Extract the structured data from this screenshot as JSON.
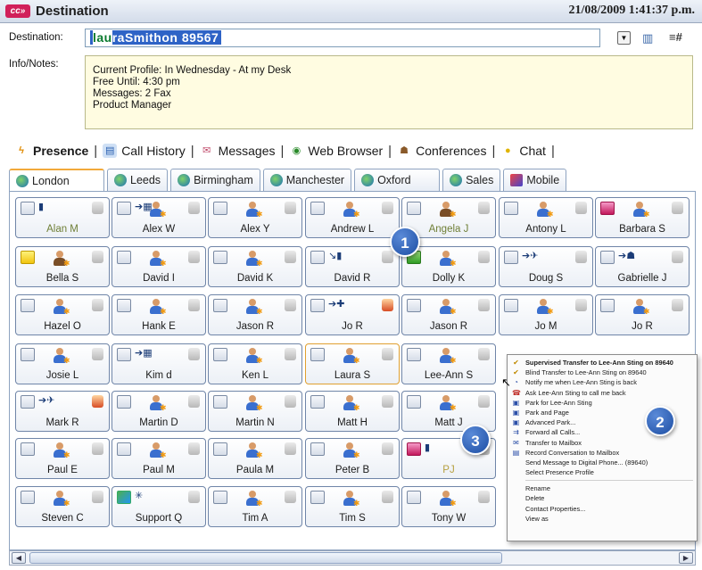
{
  "window": {
    "title": "Destination",
    "datetime": "21/08/2009 1:41:37 p.m."
  },
  "destination": {
    "label": "Destination:",
    "typed": "lau",
    "autocomplete": "raSmithon 89567"
  },
  "info": {
    "label": "Info/Notes:",
    "lines": [
      "Current Profile: In Wednesday - At my Desk",
      "Free Until: 4:30 pm",
      "Messages: 2 Fax",
      "Product Manager"
    ]
  },
  "main_tabs": [
    "Presence",
    "Call History",
    "Messages",
    "Web Browser",
    "Conferences",
    "Chat"
  ],
  "location_tabs": [
    "London",
    "Leeds",
    "Birmingham",
    "Manchester",
    "Oxford",
    "Sales",
    "Mobile"
  ],
  "contacts": [
    [
      "Alan M",
      "Alex W",
      "Alex Y",
      "Andrew L",
      "Angela J",
      "Antony L",
      "Barbara S"
    ],
    [
      "Bella S",
      "David I",
      "David K",
      "David R",
      "Dolly K",
      "Doug S",
      "Gabrielle J"
    ],
    [
      "Hazel O",
      "Hank E",
      "Jason R",
      "Jo R",
      "Jason R",
      "Jo M",
      "Jo R"
    ],
    [
      "Josie L",
      "Kim d",
      "Ken L",
      "Laura S",
      "Lee-Ann S",
      "",
      ""
    ],
    [
      "Mark R",
      "Martin D",
      "Martin N",
      "Matt H",
      "Matt J",
      "",
      ""
    ],
    [
      "Paul E",
      "Paul M",
      "Paula M",
      "Peter B",
      "PJ",
      "",
      ""
    ],
    [
      "Steven C",
      "Support Q",
      "Tim A",
      "Tim S",
      "Tony W",
      "",
      ""
    ]
  ],
  "context_menu": {
    "items": [
      {
        "label": "Supervised Transfer to Lee-Ann Sting on 89640",
        "bold": true,
        "icon": "transfer-icon"
      },
      {
        "label": "Blind Transfer to Lee-Ann Sting on 89640",
        "bold": false,
        "icon": "blind-transfer-icon"
      },
      {
        "label": "Notify me when Lee-Ann Sting is back",
        "bold": false,
        "icon": "notify-icon"
      },
      {
        "label": "Ask Lee-Ann Sting to call me back",
        "bold": false,
        "icon": "callback-icon"
      },
      {
        "label": "Park for Lee-Ann Sting",
        "bold": false,
        "icon": "park-icon"
      },
      {
        "label": "Park and Page",
        "bold": false,
        "icon": "park-page-icon"
      },
      {
        "label": "Advanced Park...",
        "bold": false,
        "icon": "advanced-park-icon"
      },
      {
        "label": "Forward all Calls...",
        "bold": false,
        "icon": "forward-icon"
      },
      {
        "label": "Transfer to Mailbox",
        "bold": false,
        "icon": "mailbox-icon"
      },
      {
        "label": "Record Conversation to Mailbox",
        "bold": false,
        "icon": "record-icon"
      },
      {
        "label": "Send Message to Digital Phone... (89640)",
        "bold": false,
        "icon": ""
      },
      {
        "label": "Select Presence Profile",
        "bold": false,
        "icon": ""
      }
    ],
    "items2": [
      "Rename",
      "Delete",
      "Contact Properties...",
      "View as"
    ]
  },
  "callouts": [
    "1",
    "2",
    "3"
  ]
}
